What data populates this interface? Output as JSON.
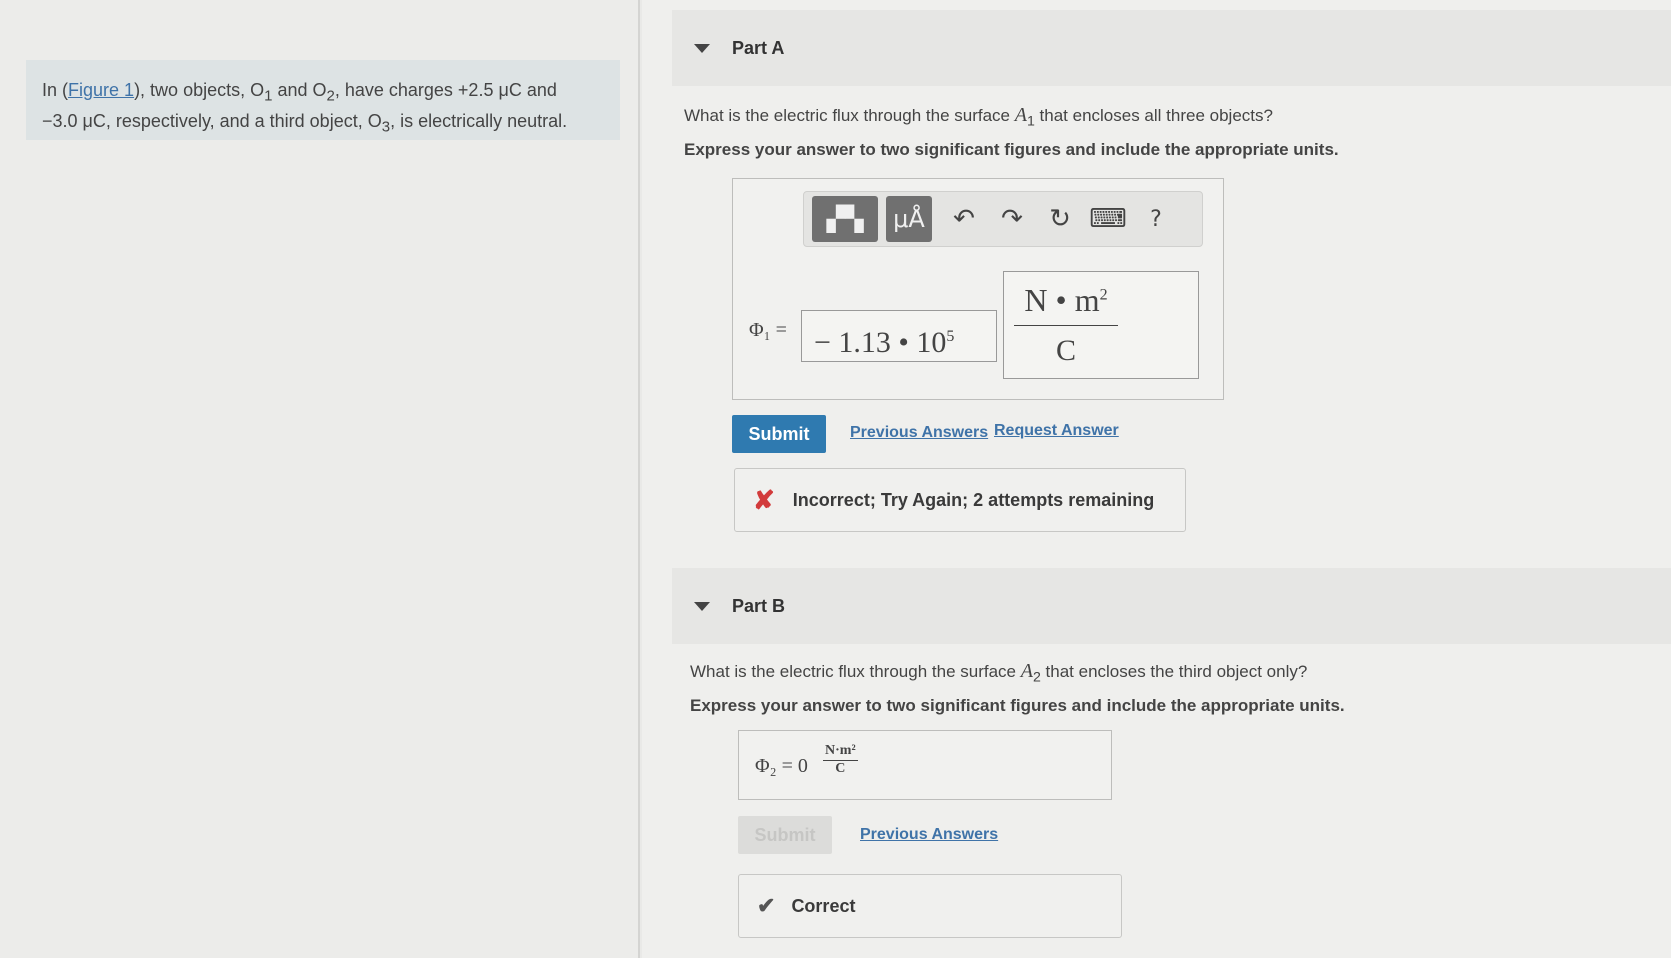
{
  "intro": {
    "prefix": "In (",
    "figure_link": "Figure 1",
    "line1_rest": "), two objects, O",
    "o1_sub": "1",
    "and": " and O",
    "o2_sub": "2",
    "have_charges": ", have charges +2.5 μC and",
    "line2": "−3.0 μC, respectively, and a third object, O",
    "o3_sub": "3",
    "line2_end": ", is electrically neutral."
  },
  "part_a": {
    "title": "Part A",
    "question_prefix": "What is the electric flux through the surface ",
    "question_var": "A",
    "question_sub": "1",
    "question_suffix": " that encloses all three objects?",
    "instruction": "Express your answer to two significant figures and include the appropriate units.",
    "toolbar": {
      "templates_icon": "▞▚",
      "units_label": "μÅ",
      "undo_icon": "↶",
      "redo_icon": "↷",
      "reset_icon": "↻",
      "keyboard_icon": "⌨",
      "help_icon": "?"
    },
    "phi_label": "Φ₁ =",
    "value": "− 1.13 • 10",
    "value_exp": "5",
    "unit_numerator": "N • m",
    "unit_num_exp": "2",
    "unit_denominator": "C",
    "submit_label": "Submit",
    "previous_answers": "Previous Answers",
    "request_answer": "Request Answer",
    "feedback_icon": "✘",
    "feedback": "Incorrect; Try Again; 2 attempts remaining"
  },
  "part_b": {
    "title": "Part B",
    "question_prefix": "What is the electric flux through the surface ",
    "question_var": "A",
    "question_sub": "2",
    "question_suffix": " that encloses the third object only?",
    "instruction": "Express your answer to two significant figures and include the appropriate units.",
    "phi_label": "Φ₂ = 0",
    "unit_numerator": "N·m²",
    "unit_denominator": "C",
    "submit_label": "Submit",
    "previous_answers": "Previous Answers",
    "feedback_icon": "✔",
    "feedback": "Correct"
  }
}
